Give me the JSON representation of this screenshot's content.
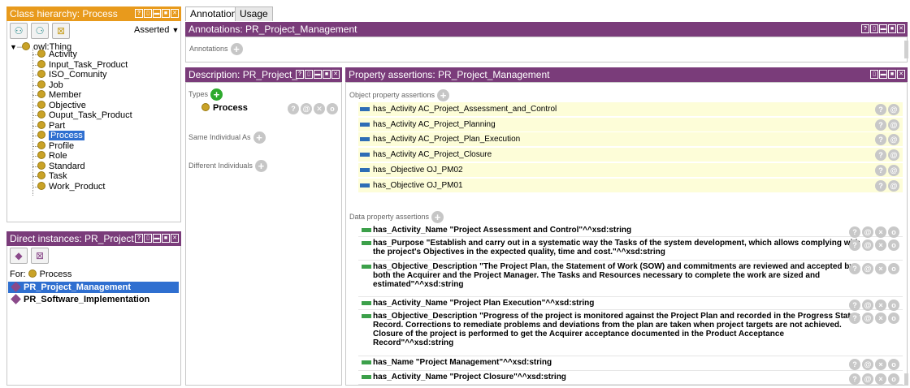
{
  "class_hierarchy": {
    "title": "Class hierarchy: Process",
    "asserted_label": "Asserted",
    "root": "owl:Thing",
    "items": [
      "Activity",
      "Input_Task_Product",
      "ISO_Comunity",
      "Job",
      "Member",
      "Objective",
      "Ouput_Task_Product",
      "Part",
      "Process",
      "Profile",
      "Role",
      "Standard",
      "Task",
      "Work_Product"
    ],
    "selected": "Process"
  },
  "direct_instances": {
    "title": "Direct instances: PR_Project",
    "for_label": "For:",
    "for_class": "Process",
    "items": [
      "PR_Project_Management",
      "PR_Software_Implementation"
    ]
  },
  "tabs": [
    "Annotations",
    "Usage"
  ],
  "annotations": {
    "title": "Annotations: PR_Project_Management",
    "label": "Annotations"
  },
  "description": {
    "title": "Description: PR_Project_",
    "types_label": "Types",
    "type_value": "Process",
    "same_label": "Same Individual As",
    "different_label": "Different Individuals"
  },
  "property_assertions": {
    "title": "Property assertions: PR_Project_Management",
    "object_label": "Object property assertions",
    "object_rows": [
      "has_Activity  AC_Project_Assessment_and_Control",
      "has_Activity  AC_Project_Planning",
      "has_Activity  AC_Project_Plan_Execution",
      "has_Activity  AC_Project_Closure",
      "has_Objective  OJ_PM02",
      "has_Objective  OJ_PM01"
    ],
    "data_label": "Data property assertions",
    "data_rows": [
      "has_Activity_Name  \"Project Assessment and Control\"^^xsd:string",
      "has_Purpose  \"Establish and carry out in a systematic way the Tasks of the system development, which allows complying with the project's Objectives in the expected quality, time and cost.\"^^xsd:string",
      "has_Objective_Description  \"The Project Plan, the Statement of Work (SOW) and commitments are reviewed and accepted by both the Acquirer and the Project Manager. The Tasks and Resources necessary to complete the work are sized and estimated\"^^xsd:string",
      "has_Activity_Name  \"Project Plan Execution\"^^xsd:string",
      "has_Objective_Description  \"Progress of the project is monitored against the Project Plan and recorded in the Progress Status Record. Corrections to remediate problems and deviations from the plan are taken when project targets are not achieved. Closure of the project is performed to get the Acquirer acceptance documented in the Product Acceptance Record\"^^xsd:string",
      "has_Name  \"Project Management\"^^xsd:string",
      "has_Activity_Name  \"Project Closure\"^^xsd:string"
    ]
  },
  "row_buttons": {
    "help": "?",
    "annotate": "@",
    "delete": "×",
    "edit": "o"
  }
}
